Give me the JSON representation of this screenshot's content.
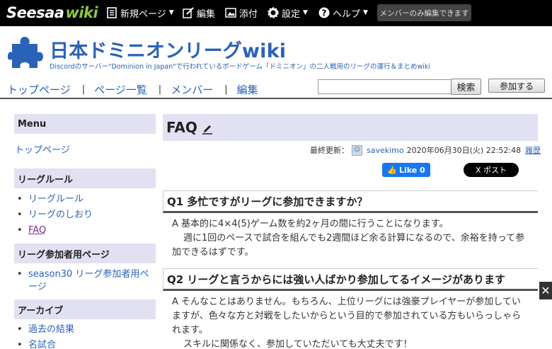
{
  "topbar": {
    "logo_main": "Seesaa",
    "logo_wiki": "wiki",
    "new_page": "新規ページ",
    "edit": "編集",
    "attach": "添付",
    "settings": "設定",
    "help": "ヘルプ",
    "member_only": "メンバーのみ編集できます"
  },
  "header": {
    "site_title": "日本ドミニオンリーグwiki",
    "site_desc": "Discordのサーバー\"Dominion in Japan\"で行われているボードゲーム「ドミニオン」の二人戦用のリーグの運行＆まとめwiki",
    "nav": [
      "トップページ",
      "ページ一覧",
      "メンバー",
      "編集"
    ],
    "nav_sep": "|",
    "search_label": "検索",
    "join_label": "参加する"
  },
  "sidebar": {
    "menu_title": "Menu",
    "top_link": "トップページ",
    "league_title": "リーグルール",
    "league_items": [
      "リーグルール",
      "リーグのしおり",
      "FAQ"
    ],
    "participant_title": "リーグ参加者用ページ",
    "participant_items": [
      "season30 リーグ参加者用ページ"
    ],
    "archive_title": "アーカイブ",
    "archive_items": [
      "過去の結果",
      "名試合"
    ]
  },
  "main": {
    "page_title": "FAQ",
    "updated_label": "最終更新：",
    "author": "savekimo",
    "updated_at": "2020年06月30日(火) 22:52:48",
    "history": "履歴",
    "fb_like": "Like 0",
    "x_post": "X ポスト",
    "q1_title": "Q1 多忙ですがリーグに参加できますか？",
    "q1_line1": "A 基本的に4×4(5)ゲーム数を約2ヶ月の間に行うことになります。",
    "q1_line2": "週に1回のペースで試合を組んでも2週間ほど余る計算になるので、余裕を持って参加できるはずです。",
    "q2_title": "Q2 リーグと言うからには強い人ばかり参加してるイメージがあります",
    "q2_line1": "A そんなことはありません。もちろん、上位リーグには強豪プレイヤーが参加していますが、色々な方と対戦をしたいからという目的で参加されている方もいらっしゃられます。",
    "q2_line2": "スキルに関係なく、参加していただいても大丈夫です！"
  },
  "close_glyph": "✕",
  "colors": {
    "link": "#2a62b8",
    "section_bg": "#e1e1f2",
    "wiki_green": "#8ec63f"
  }
}
